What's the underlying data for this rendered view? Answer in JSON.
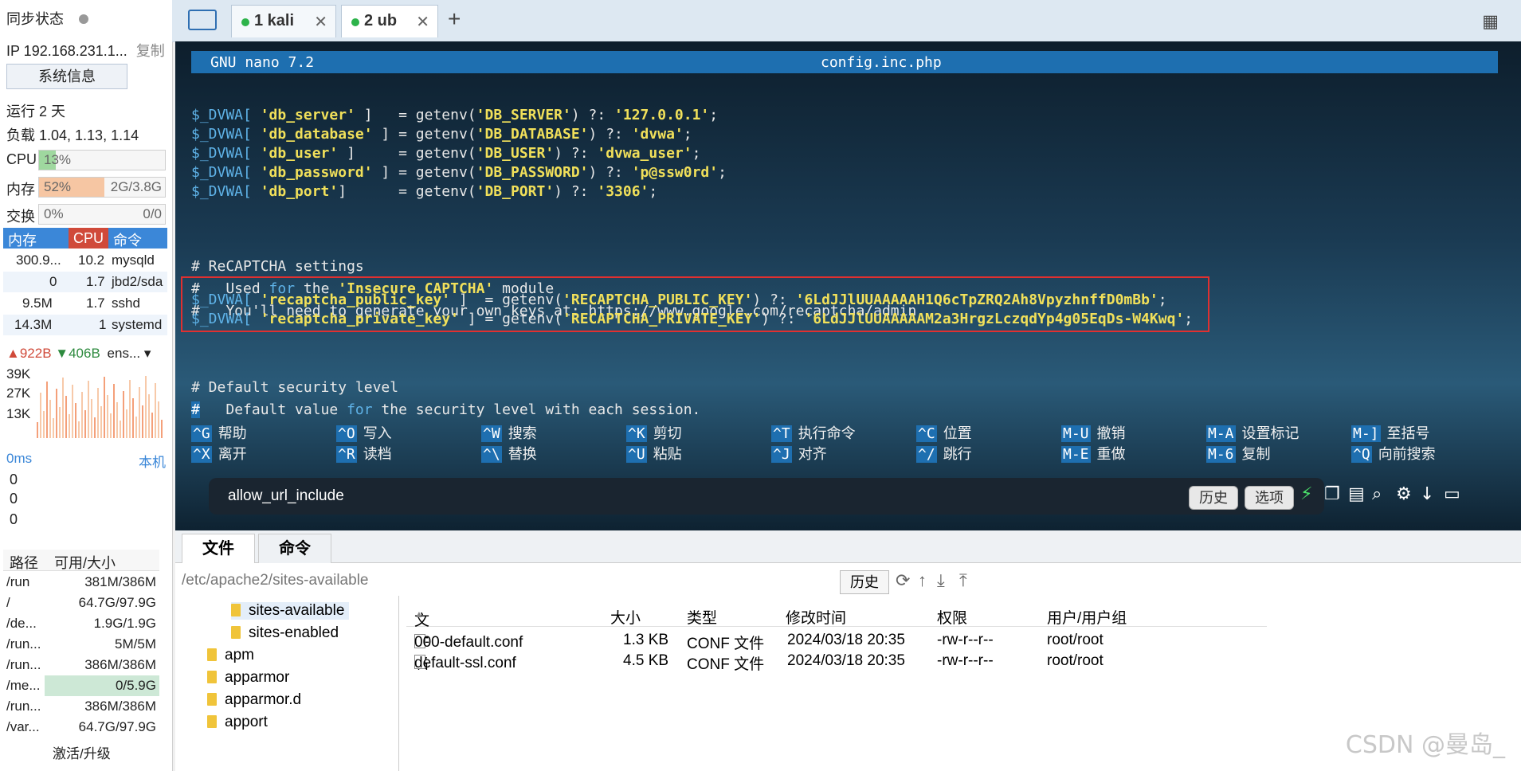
{
  "sidebar": {
    "sync_status": "同步状态",
    "ip": "IP 192.168.231.1...",
    "copy": "复制",
    "sysinfo_button": "系统信息",
    "uptime": "运行 2 天",
    "load": "负载 1.04, 1.13, 1.14",
    "cpu_label": "CPU",
    "cpu_value": "13%",
    "cpu_fraction": 0.13,
    "mem_label": "内存",
    "mem_value": "52%",
    "mem_total": "2G/3.8G",
    "mem_fraction": 0.52,
    "swap_label": "交换",
    "swap_value": "0%",
    "swap_total": "0/0",
    "proc_headers": [
      "内存",
      "CPU",
      "命令"
    ],
    "processes": [
      {
        "mem": "300.9...",
        "cpu": "10.2",
        "cmd": "mysqld"
      },
      {
        "mem": "0",
        "cpu": "1.7",
        "cmd": "jbd2/sda"
      },
      {
        "mem": "9.5M",
        "cpu": "1.7",
        "cmd": "sshd"
      },
      {
        "mem": "14.3M",
        "cpu": "1",
        "cmd": "systemd"
      }
    ],
    "net_up": "922B",
    "net_down": "406B",
    "net_iface": "ens...",
    "net_ticks": [
      "39K",
      "27K",
      "13K"
    ],
    "latency_label": "0ms",
    "latency_host": "本机",
    "latency_values": [
      "0",
      "0",
      "0"
    ],
    "disk_headers": [
      "路径",
      "可用/大小"
    ],
    "disks": [
      {
        "path": "/run",
        "size": "381M/386M"
      },
      {
        "path": "/",
        "size": "64.7G/97.9G"
      },
      {
        "path": "/de...",
        "size": "1.9G/1.9G"
      },
      {
        "path": "/run...",
        "size": "5M/5M"
      },
      {
        "path": "/run...",
        "size": "386M/386M"
      },
      {
        "path": "/me...",
        "size": "0/5.9G"
      },
      {
        "path": "/run...",
        "size": "386M/386M"
      },
      {
        "path": "/var...",
        "size": "64.7G/97.9G"
      }
    ],
    "activate": "激活/升级"
  },
  "tabs": [
    {
      "label": "1 kali"
    },
    {
      "label": "2 ub"
    }
  ],
  "terminal": {
    "app": "GNU nano 7.2",
    "filename": "config.inc.php",
    "lines": [
      {
        "var": "$_DVWA[",
        "key": " 'db_server' ",
        "rest": "]   = getenv(",
        "env": "'DB_SERVER'",
        "mid": ") ?: ",
        "val": "'127.0.0.1'",
        "end": ";"
      },
      {
        "var": "$_DVWA[",
        "key": " 'db_database' ",
        "rest": "] = getenv(",
        "env": "'DB_DATABASE'",
        "mid": ") ?: ",
        "val": "'dvwa'",
        "end": ";"
      },
      {
        "var": "$_DVWA[",
        "key": " 'db_user' ",
        "rest": "]     = getenv(",
        "env": "'DB_USER'",
        "mid": ") ?: ",
        "val": "'dvwa_user'",
        "end": ";"
      },
      {
        "var": "$_DVWA[",
        "key": " 'db_password' ",
        "rest": "] = getenv(",
        "env": "'DB_PASSWORD'",
        "mid": ") ?: ",
        "val": "'p@ssw0rd'",
        "end": ";"
      },
      {
        "var": "$_DVWA[",
        "key": " 'db_port'",
        "rest": "]      = getenv(",
        "env": "'DB_PORT'",
        "mid": ") ?: ",
        "val": "'3306'",
        "end": ";"
      }
    ],
    "comment1": "# ReCAPTCHA settings",
    "comment2_a": "#   Used ",
    "comment2_kw": "for",
    "comment2_b": " the ",
    "comment2_c": "'Insecure CAPTCHA'",
    "comment2_d": " module",
    "comment3": "#   You'll need to generate your own keys at: https://www.google.com/recaptcha/admin",
    "recaptcha": [
      {
        "var": "$_DVWA[",
        "key": " 'recaptcha_public_key' ",
        "rest": "]  = getenv(",
        "env": "'RECAPTCHA_PUBLIC_KEY'",
        "mid": ") ?: ",
        "val": "'6LdJJlUUAAAAAH1Q6cTpZRQ2Ah8VpyzhnffD0mBb'",
        "end": ";"
      },
      {
        "var": "$_DVWA[",
        "key": " 'recaptcha_private_key' ",
        "rest": "] = getenv(",
        "env": "'RECAPTCHA_PRIVATE_KEY'",
        "mid": ") ?: ",
        "val": "'6LdJJlUUAAAAAM2a3HrgzLczqdYp4g05EqDs-W4Kwq'",
        "end": ";"
      }
    ],
    "comment4": "# Default security level",
    "comment5_a": "#",
    "comment5_b": "   Default value ",
    "comment5_kw": "for",
    "comment5_c": " the security level with each session.",
    "shortcuts": [
      {
        "key": "^G",
        "label": "帮助"
      },
      {
        "key": "^O",
        "label": "写入"
      },
      {
        "key": "^W",
        "label": "搜索"
      },
      {
        "key": "^K",
        "label": "剪切"
      },
      {
        "key": "^T",
        "label": "执行命令"
      },
      {
        "key": "^C",
        "label": "位置"
      },
      {
        "key": "M-U",
        "label": "撤销"
      },
      {
        "key": "M-A",
        "label": "设置标记"
      },
      {
        "key": "M-]",
        "label": "至括号"
      },
      {
        "key": "^X",
        "label": "离开"
      },
      {
        "key": "^R",
        "label": "读档"
      },
      {
        "key": "^\\",
        "label": "替换"
      },
      {
        "key": "^U",
        "label": "粘贴"
      },
      {
        "key": "^J",
        "label": "对齐"
      },
      {
        "key": "^/",
        "label": "跳行"
      },
      {
        "key": "M-E",
        "label": "重做"
      },
      {
        "key": "M-6",
        "label": "复制"
      },
      {
        "key": "^Q",
        "label": "向前搜索"
      }
    ],
    "command_input": "allow_url_include",
    "history_btn": "历史",
    "options_btn": "选项"
  },
  "filemanager": {
    "tab_files": "文件",
    "tab_commands": "命令",
    "path": "/etc/apache2/sites-available",
    "history_btn": "历史",
    "tree": [
      "sites-available",
      "sites-enabled",
      "apm",
      "apparmor",
      "apparmor.d",
      "apport"
    ],
    "headers": [
      "文件名",
      "大小",
      "类型",
      "修改时间",
      "权限",
      "用户/用户组"
    ],
    "files": [
      {
        "name": "000-default.conf",
        "size": "1.3 KB",
        "type": "CONF 文件",
        "mtime": "2024/03/18 20:35",
        "perm": "-rw-r--r--",
        "owner": "root/root"
      },
      {
        "name": "default-ssl.conf",
        "size": "4.5 KB",
        "type": "CONF 文件",
        "mtime": "2024/03/18 20:35",
        "perm": "-rw-r--r--",
        "owner": "root/root"
      }
    ]
  },
  "watermark": "CSDN @曼岛_"
}
